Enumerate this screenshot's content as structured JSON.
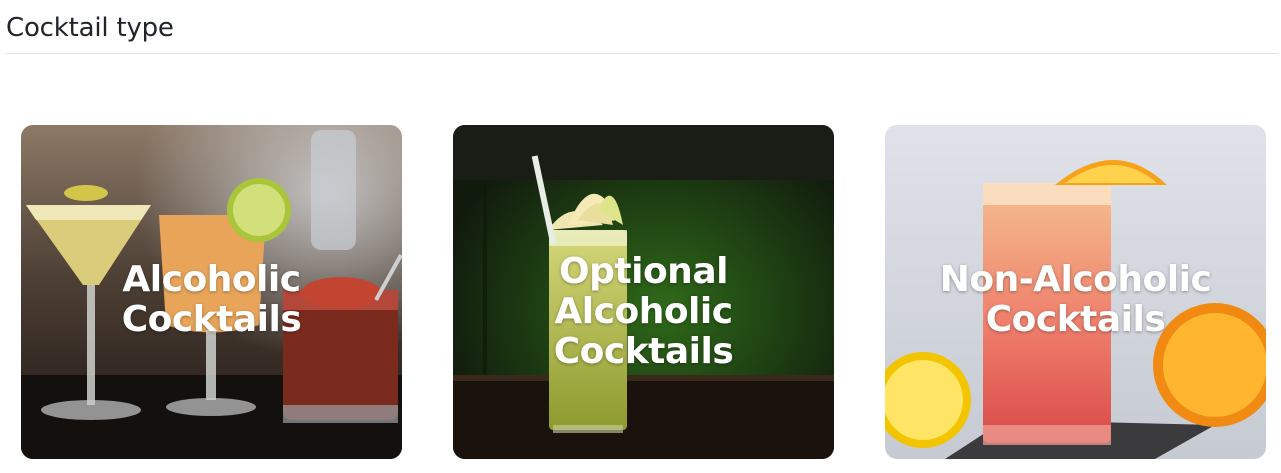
{
  "header": {
    "title": "Cocktail type"
  },
  "cards": [
    {
      "label": "Alcoholic Cocktails"
    },
    {
      "label": "Optional Alcoholic Cocktails"
    },
    {
      "label": "Non-Alcoholic Cocktails"
    }
  ]
}
